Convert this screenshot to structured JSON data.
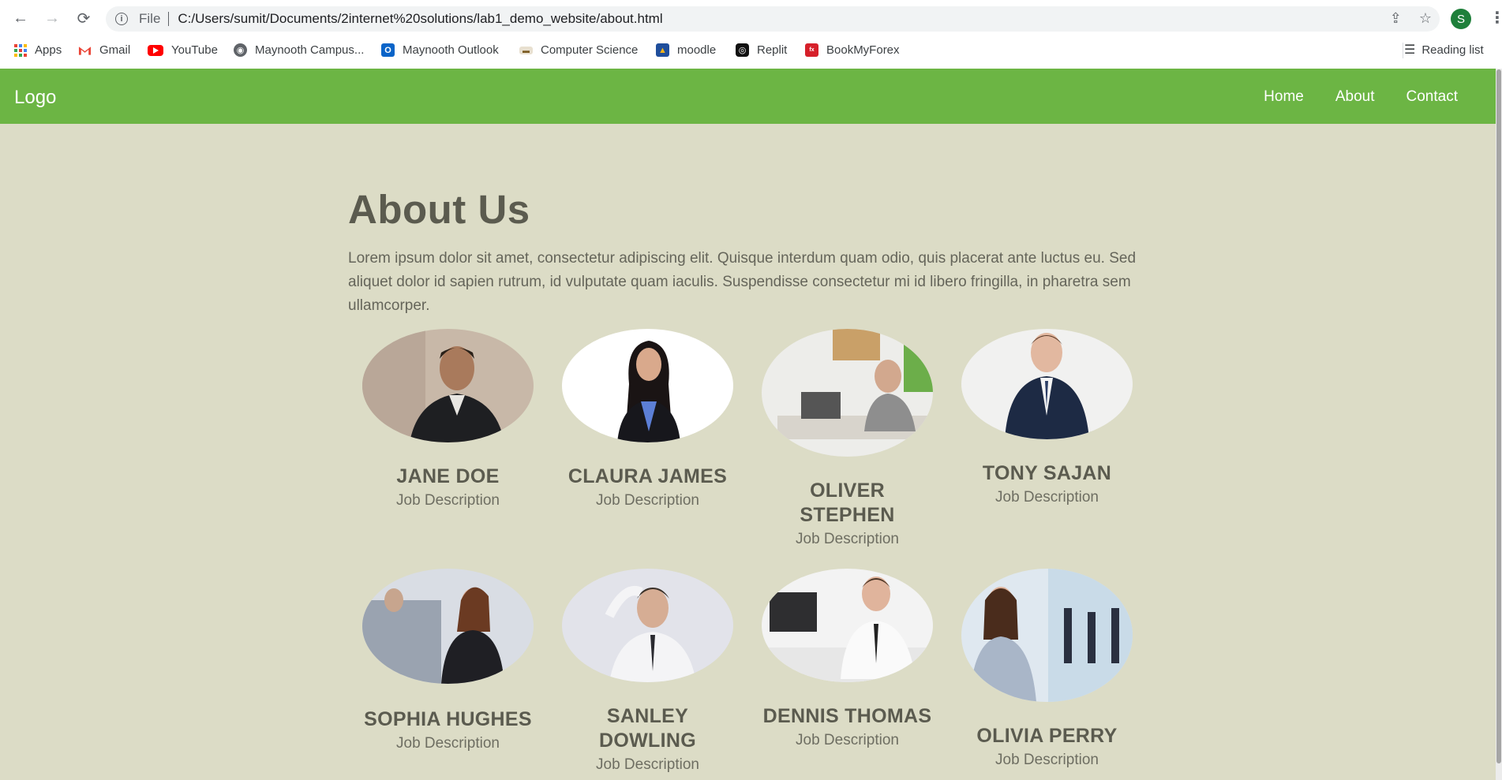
{
  "browser": {
    "back_label": "←",
    "forward_label": "→",
    "reload_label": "⟳",
    "file_label": "File",
    "url": "C:/Users/sumit/Documents/2internet%20solutions/lab1_demo_website/about.html",
    "profile_initial": "S",
    "bookmarks": [
      {
        "label": "Apps",
        "icon": "apps-grid-icon"
      },
      {
        "label": "Gmail",
        "icon": "gmail-icon"
      },
      {
        "label": "YouTube",
        "icon": "youtube-icon"
      },
      {
        "label": "Maynooth Campus...",
        "icon": "globe-icon"
      },
      {
        "label": "Maynooth Outlook",
        "icon": "outlook-icon"
      },
      {
        "label": "Computer Science",
        "icon": "cs-icon"
      },
      {
        "label": "moodle",
        "icon": "moodle-icon"
      },
      {
        "label": "Replit",
        "icon": "replit-icon"
      },
      {
        "label": "BookMyForex",
        "icon": "bookmyforex-icon"
      }
    ],
    "reading_list": "Reading list"
  },
  "site": {
    "logo": "Logo",
    "nav": [
      "Home",
      "About",
      "Contact"
    ],
    "accent": "#6cb544",
    "background": "#dcdcc6"
  },
  "page": {
    "title": "About Us",
    "lead": "Lorem ipsum dolor sit amet, consectetur adipiscing elit. Quisque interdum quam odio, quis placerat ante luctus eu. Sed aliquet dolor id sapien rutrum, id vulputate quam iaculis. Suspendisse consectetur mi id libero fringilla, in pharetra sem ullamcorper."
  },
  "team": [
    {
      "name": "JANE DOE",
      "job": "Job Description"
    },
    {
      "name": "CLAURA JAMES",
      "job": "Job Description"
    },
    {
      "name": "OLIVER STEPHEN",
      "job": "Job Description"
    },
    {
      "name": "TONY SAJAN",
      "job": "Job Description"
    },
    {
      "name": "SOPHIA HUGHES",
      "job": "Job Description"
    },
    {
      "name": "SANLEY DOWLING",
      "job": "Job Description"
    },
    {
      "name": "DENNIS THOMAS",
      "job": "Job Description"
    },
    {
      "name": "OLIVIA PERRY",
      "job": "Job Description"
    }
  ]
}
